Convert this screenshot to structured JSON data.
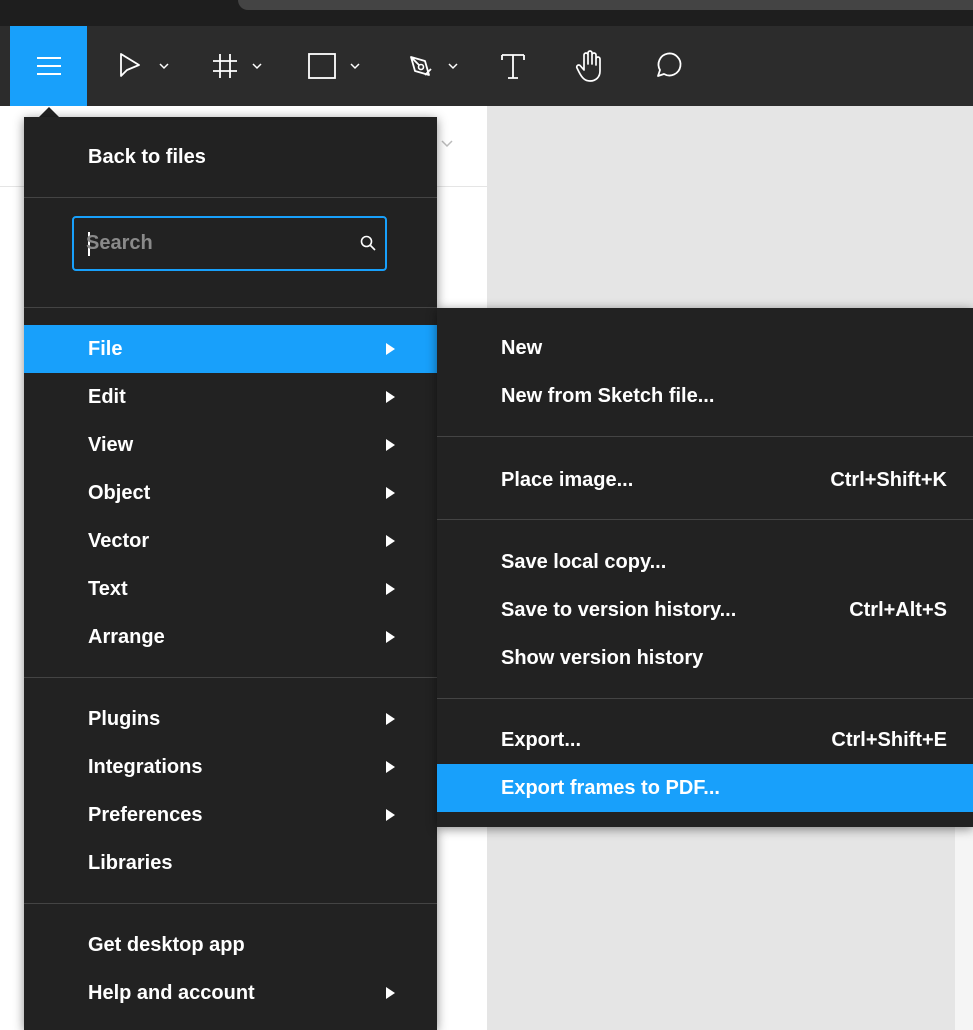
{
  "menu": {
    "back_label": "Back to files",
    "search_placeholder": "Search",
    "items": [
      {
        "label": "File",
        "has_submenu": true,
        "active": true
      },
      {
        "label": "Edit",
        "has_submenu": true
      },
      {
        "label": "View",
        "has_submenu": true
      },
      {
        "label": "Object",
        "has_submenu": true
      },
      {
        "label": "Vector",
        "has_submenu": true
      },
      {
        "label": "Text",
        "has_submenu": true
      },
      {
        "label": "Arrange",
        "has_submenu": true
      },
      {
        "label": "Plugins",
        "has_submenu": true
      },
      {
        "label": "Integrations",
        "has_submenu": true
      },
      {
        "label": "Preferences",
        "has_submenu": true
      },
      {
        "label": "Libraries",
        "has_submenu": false
      },
      {
        "label": "Get desktop app",
        "has_submenu": false
      },
      {
        "label": "Help and account",
        "has_submenu": true
      }
    ]
  },
  "submenu": {
    "items": [
      {
        "label": "New",
        "shortcut": ""
      },
      {
        "label": "New from Sketch file...",
        "shortcut": ""
      },
      {
        "label": "Place image...",
        "shortcut": "Ctrl+Shift+K"
      },
      {
        "label": "Save local copy...",
        "shortcut": ""
      },
      {
        "label": "Save to version history...",
        "shortcut": "Ctrl+Alt+S"
      },
      {
        "label": "Show version history",
        "shortcut": ""
      },
      {
        "label": "Export...",
        "shortcut": "Ctrl+Shift+E"
      },
      {
        "label": "Export frames to PDF...",
        "shortcut": "",
        "active": true
      }
    ]
  },
  "toolbar": {
    "tools": [
      "menu-icon",
      "move-tool-icon",
      "frame-tool-icon",
      "rectangle-tool-icon",
      "pen-tool-icon",
      "text-tool-icon",
      "hand-tool-icon",
      "comment-tool-icon"
    ]
  },
  "colors": {
    "accent": "#18a0fb",
    "menu_bg": "#222222",
    "toolbar_bg": "#2c2c2c",
    "separator": "#444444"
  }
}
